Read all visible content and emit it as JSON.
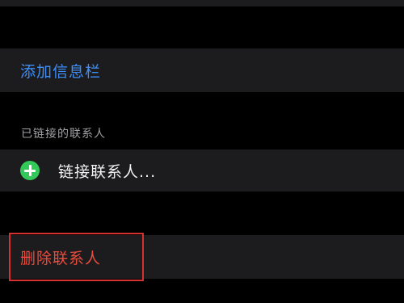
{
  "add_field": {
    "label": "添加信息栏"
  },
  "linked_contacts": {
    "section_header": "已链接的联系人",
    "link_action_label": "链接联系人..."
  },
  "delete": {
    "label": "删除联系人"
  },
  "colors": {
    "background": "#000000",
    "cell": "#1c1c1e",
    "blue_action": "#3e8ef7",
    "green_plus": "#34c759",
    "red_destructive": "#eb4d3d",
    "highlight_box": "#d63030"
  },
  "icons": [
    "plus-circle-icon"
  ]
}
